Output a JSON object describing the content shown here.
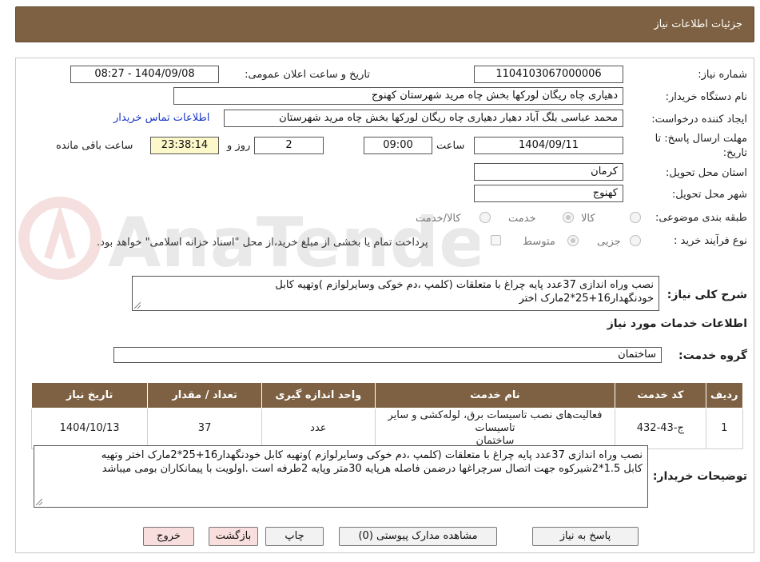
{
  "header": {
    "title": "جزئیات اطلاعات نیاز"
  },
  "form": {
    "need_number": {
      "label": "شماره نیاز:",
      "value": "1104103067000006"
    },
    "announce_datetime": {
      "label": "تاریخ و ساعت اعلان عمومی:",
      "value": "1404/09/08 - 08:27"
    },
    "buyer_org": {
      "label": "نام دستگاه خریدار:",
      "value": "دهیاری چاه ریگان لورکها بخش چاه مرید شهرستان کهنوج"
    },
    "requester": {
      "label": "ایجاد کننده درخواست:",
      "value": "محمد عباسی بلگ آباد دهیار دهیاری چاه ریگان لورکها بخش چاه مرید شهرستان",
      "contact_link": "اطلاعات تماس خریدار"
    },
    "deadline": {
      "label_line1": "مهلت ارسال پاسخ: تا",
      "label_line2": "تاریخ:",
      "date": "1404/09/11",
      "time_label": "ساعت",
      "time": "09:00",
      "days": "2",
      "days_label": "روز و",
      "remaining_time": "23:38:14",
      "remaining_label": "ساعت باقی مانده"
    },
    "province": {
      "label": "استان محل تحویل:",
      "value": "کرمان"
    },
    "city": {
      "label": "شهر محل تحویل:",
      "value": "کهنوج"
    },
    "category": {
      "label": "طبقه بندی موضوعی:",
      "options": [
        "کالا",
        "خدمت",
        "کالا/خدمت"
      ],
      "selected": "خدمت"
    },
    "process_type": {
      "label": "نوع فرآیند خرید :",
      "options": [
        "جزیی",
        "متوسط"
      ],
      "selected": "متوسط",
      "payment_note": "پرداخت تمام یا بخشی از مبلغ خرید،از محل \"اسناد خزانه اسلامی\" خواهد بود."
    },
    "general_description": {
      "label": "شرح کلی نیاز:",
      "line1": "نصب وراه اندازی 37عدد پایه چراغ با متعلقات (کلمپ ،دم خوکی وسایرلوازم )وتهیه کابل",
      "line2": "خودنگهدار16+25*2مارک اختر"
    }
  },
  "services": {
    "section_title": "اطلاعات خدمات مورد نیاز",
    "group_label": "گروه خدمت:",
    "group_value": "ساختمان",
    "table": {
      "headers": [
        "ردیف",
        "کد خدمت",
        "نام خدمت",
        "واحد اندازه گیری",
        "تعداد / مقدار",
        "تاریخ نیاز"
      ],
      "rows": [
        {
          "row": "1",
          "code": "ج-43-432",
          "name_line1": "فعالیت‌های نصب تاسیسات برق، لوله‌کشی و سایر تاسیسات",
          "name_line2": "ساختمان",
          "unit": "عدد",
          "quantity": "37",
          "date": "1404/10/13"
        }
      ]
    }
  },
  "buyer_notes": {
    "label": "توضیحات خریدار:",
    "line1": "نصب وراه اندازی 37عدد پایه چراغ با متعلقات (کلمپ ،دم خوکی وسایرلوازم )وتهیه کابل خودنگهدار16+25*2مارک اختر وتهیه",
    "line2": "کابل 1.5*2شیرکوه جهت اتصال سرچراغها درضمن فاصله هرپایه 30متر وپایه 2طرفه است .اولویت با پیمانکاران بومی میباشد"
  },
  "buttons": {
    "reply": "پاسخ به نیاز",
    "attachments": "مشاهده مدارک پیوستی (0)",
    "print": "چاپ",
    "back": "بازگشت",
    "exit": "خروج"
  },
  "colors": {
    "header_bg": "#7d6142",
    "link": "#1a37c8",
    "remaining_bg": "#fdf8c9",
    "exit_btn": "#f9dede"
  }
}
